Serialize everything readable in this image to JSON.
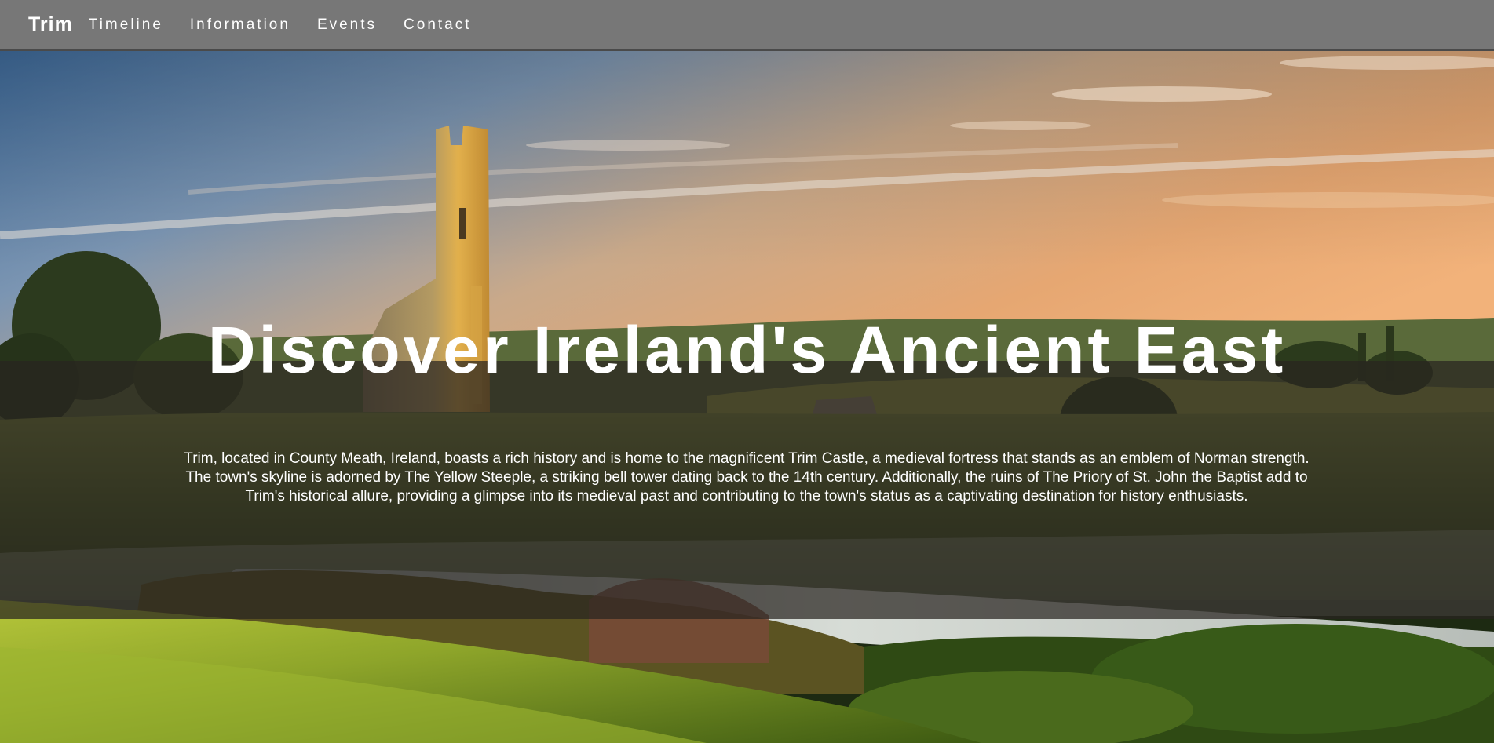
{
  "navbar": {
    "brand": "Trim",
    "links": [
      "Timeline",
      "Information",
      "Events",
      "Contact"
    ]
  },
  "hero": {
    "title": "Discover Ireland's Ancient East",
    "description": "Trim, located in County Meath, Ireland, boasts a rich history and is home to the magnificent Trim Castle, a medieval fortress that stands as an emblem of Norman strength. The town's skyline is adorned by The Yellow Steeple, a striking bell tower dating back to the 14th century. Additionally, the ruins of The Priory of St. John the Baptist add to Trim's historical allure, providing a glimpse into its medieval past and contributing to the town's status as a captivating destination for history enthusiasts."
  },
  "colors": {
    "navbar_bg": "#777777",
    "overlay": "rgba(40,36,32,0.72)",
    "text": "#ffffff"
  }
}
